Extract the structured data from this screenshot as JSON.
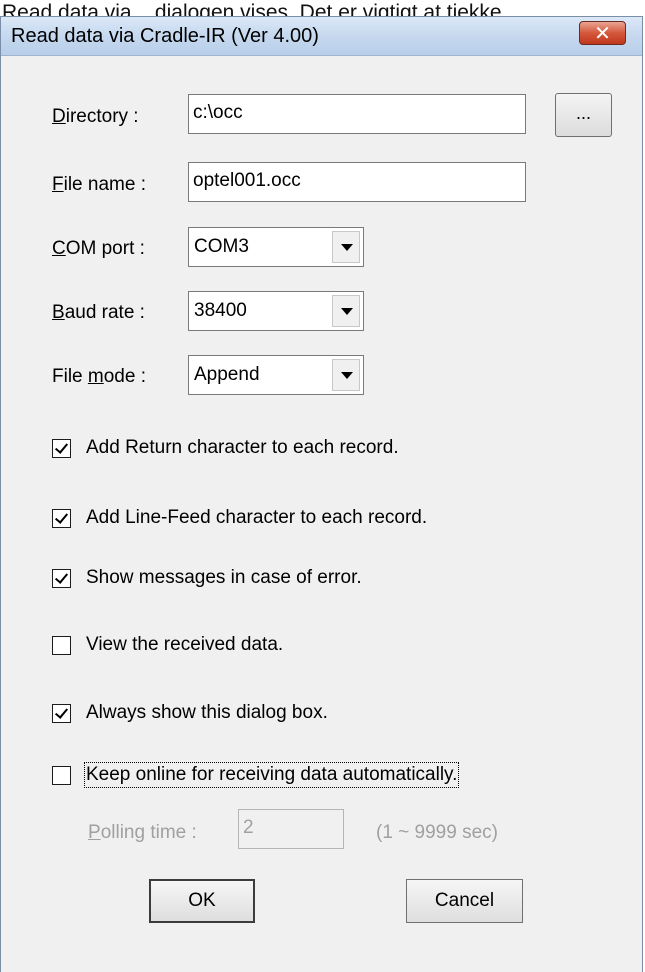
{
  "caption_text": "Read data via... dialogen vises. Det er vigtigt at tjekke",
  "window": {
    "title": "Read data via Cradle-IR (Ver 4.00)",
    "close_symbol": "✕"
  },
  "fields": {
    "directory": {
      "label_key": "D",
      "label_rest": "irectory :",
      "value": "c:\\occ"
    },
    "file_name": {
      "label_key": "F",
      "label_rest": "ile name :",
      "value": "optel001.occ"
    },
    "com_port": {
      "label_key": "C",
      "label_rest": "OM port :",
      "value": "COM3"
    },
    "baud_rate": {
      "label_key": "B",
      "label_rest": "aud rate :",
      "value": "38400"
    },
    "file_mode": {
      "label_pre": "File ",
      "label_key": "m",
      "label_rest": "ode :",
      "value": "Append"
    }
  },
  "browse_button": "...",
  "checkboxes": [
    {
      "label": "Add Return character to each record.",
      "checked": true
    },
    {
      "label": "Add Line-Feed character to each record.",
      "checked": true
    },
    {
      "label": "Show messages in case of error.",
      "checked": true
    },
    {
      "label": "View the received data.",
      "checked": false
    },
    {
      "label": "Always show this dialog box.",
      "checked": true
    },
    {
      "label": "Keep online for receiving data automatically.",
      "checked": false
    }
  ],
  "polling": {
    "label_key": "P",
    "label_rest": "olling time :",
    "value": "2",
    "range": "(1 ~ 9999 sec)"
  },
  "buttons": {
    "ok": "OK",
    "cancel": "Cancel"
  },
  "colors": {
    "titlebar": "#c4d7ee",
    "close_button": "#c0381d",
    "dialog_bg": "#f0f0f0"
  }
}
